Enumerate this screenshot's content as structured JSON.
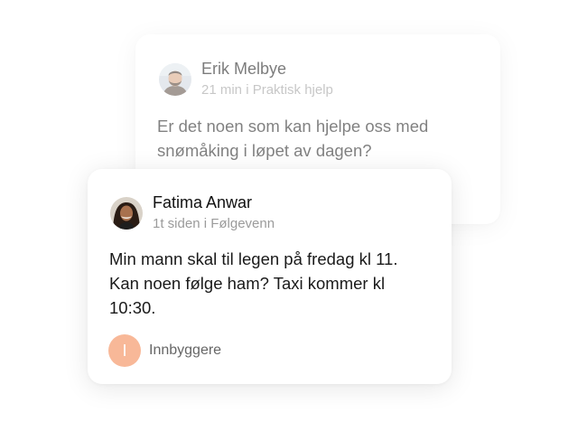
{
  "posts": [
    {
      "author": "Erik Melbye",
      "subtitle": "21 min i Praktisk hjelp",
      "body_line1": "Er det noen som kan hjelpe oss med",
      "body_line2": "snømåking i løpet av dagen?"
    },
    {
      "author": "Fatima Anwar",
      "subtitle": "1t siden i Følgevenn",
      "body_line1": "Min mann skal til legen på fredag kl 11.",
      "body_line2": "Kan noen følge ham? Taxi kommer kl",
      "body_line3": "10:30.",
      "group_initial": "I",
      "group_label": "Innbyggere"
    }
  ],
  "colors": {
    "group_badge": "#f8b898",
    "subtitle": "#9b9b9b",
    "text": "#1a1a1a"
  }
}
